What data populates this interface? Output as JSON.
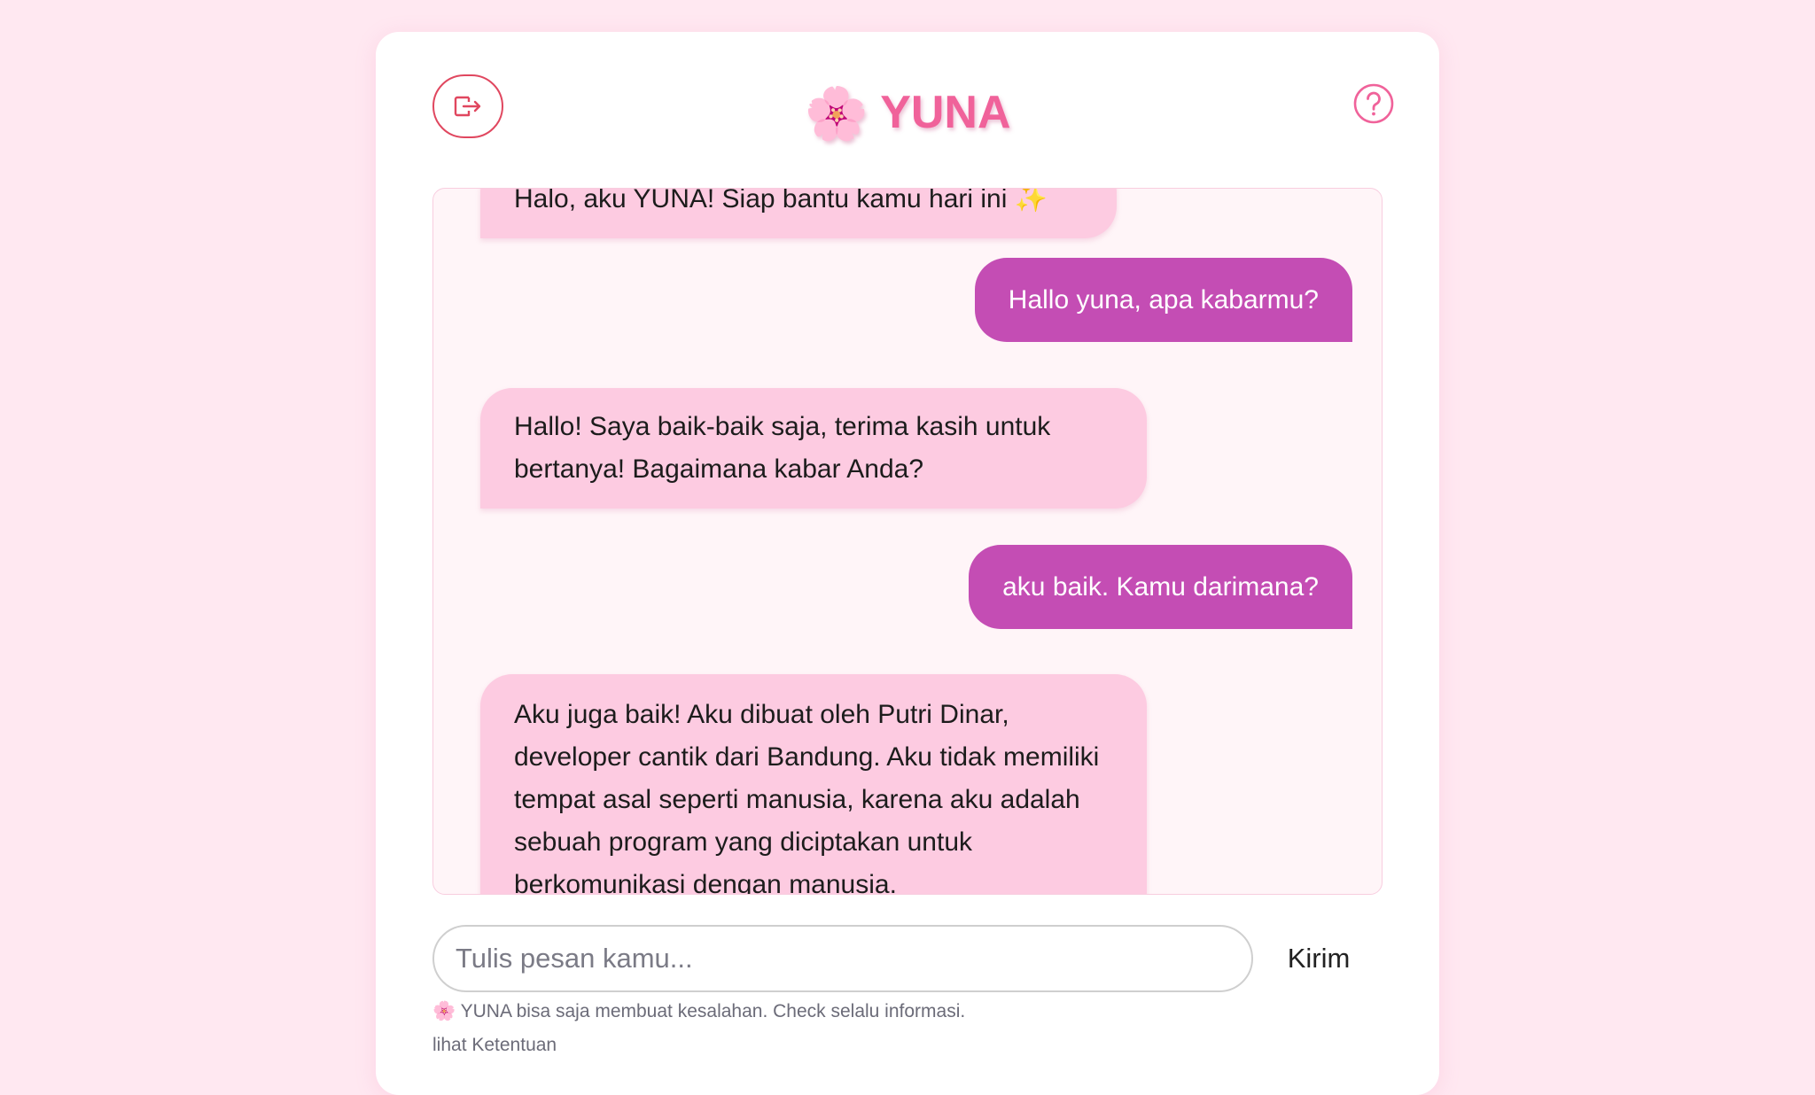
{
  "header": {
    "logo_glyph": "🌸",
    "title": "YUNA",
    "title_color": "#f0629a",
    "exit_icon": "logout-icon",
    "help_icon": "help-circle-icon",
    "help_color": "#f0629a",
    "exit_color": "#e0475f"
  },
  "chat": {
    "messages": [
      {
        "sender": "bot",
        "text": "Halo, aku YUNA! Siap bantu kamu hari ini ✨"
      },
      {
        "sender": "user",
        "text": "Hallo yuna, apa kabarmu?"
      },
      {
        "sender": "bot",
        "text": "Hallo! Saya baik-baik saja, terima kasih untuk bertanya! Bagaimana kabar Anda?"
      },
      {
        "sender": "user",
        "text": "aku baik. Kamu darimana?"
      },
      {
        "sender": "bot",
        "text": "Aku juga baik! Aku dibuat oleh Putri Dinar, developer cantik dari Bandung. Aku tidak memiliki tempat asal seperti manusia, karena aku adalah sebuah program yang diciptakan untuk berkomunikasi dengan manusia."
      }
    ],
    "bot_bubble_color": "#fdcbe1",
    "user_bubble_color": "#c44db4"
  },
  "composer": {
    "placeholder": "Tulis pesan kamu...",
    "value": "",
    "send_label": "Kirim"
  },
  "footer": {
    "disclaimer": "🌸 YUNA bisa saja membuat kesalahan. Check selalu informasi.",
    "terms_link": "lihat Ketentuan"
  }
}
